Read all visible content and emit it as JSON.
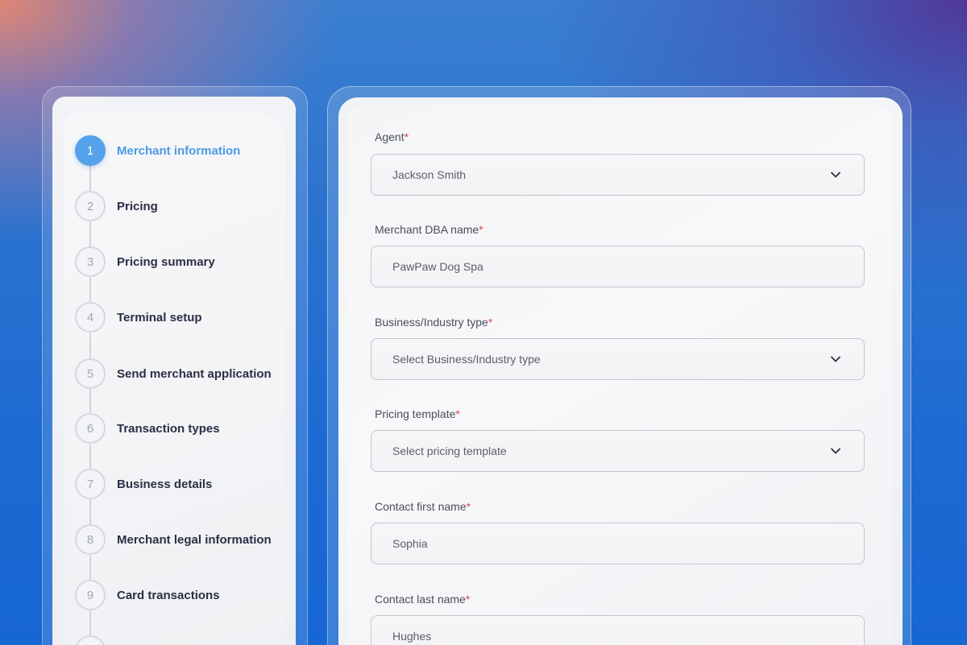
{
  "stepper": {
    "steps": [
      {
        "number": "1",
        "label": "Merchant information",
        "active": true
      },
      {
        "number": "2",
        "label": "Pricing"
      },
      {
        "number": "3",
        "label": "Pricing summary"
      },
      {
        "number": "4",
        "label": "Terminal setup"
      },
      {
        "number": "5",
        "label": "Send merchant application"
      },
      {
        "number": "6",
        "label": "Transaction types"
      },
      {
        "number": "7",
        "label": "Business details"
      },
      {
        "number": "8",
        "label": "Merchant legal information"
      },
      {
        "number": "9",
        "label": "Card transactions"
      }
    ]
  },
  "form": {
    "required_mark": "*",
    "agent": {
      "label": "Agent",
      "value": "Jackson Smith",
      "icon": "chevron-down-icon"
    },
    "dba_name": {
      "label": "Merchant DBA name",
      "value": "PawPaw Dog Spa"
    },
    "industry_type": {
      "label": "Business/Industry type",
      "placeholder": "Select Business/Industry type",
      "icon": "chevron-down-icon"
    },
    "pricing_template": {
      "label": "Pricing template",
      "placeholder": "Select pricing template",
      "icon": "chevron-down-icon"
    },
    "contact_first_name": {
      "label": "Contact first name",
      "value": "Sophia"
    },
    "contact_last_name": {
      "label": "Contact last name",
      "value": "Hughes"
    }
  },
  "colors": {
    "accent": "#55a2ea",
    "required": "#e0454a",
    "step_text": "#2b2f45"
  }
}
